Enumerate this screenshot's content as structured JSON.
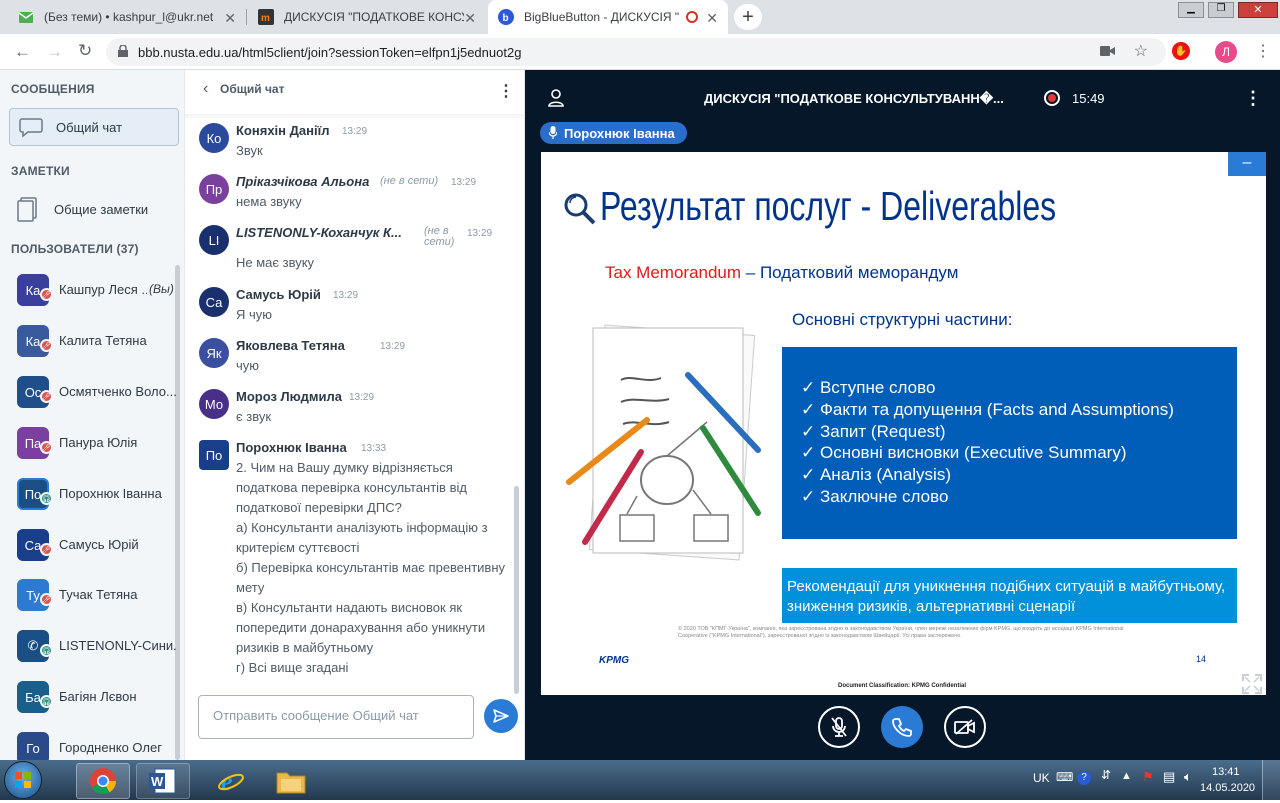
{
  "browser": {
    "tabs": [
      {
        "title": "(Без теми) • kashpur_l@ukr.net"
      },
      {
        "title": "ДИСКУСІЯ \"ПОДАТКОВЕ КОНСУ"
      },
      {
        "title": "BigBlueButton - ДИСКУСІЯ \""
      }
    ],
    "new_tab_label": "+",
    "url": "bbb.nusta.edu.ua/html5client/join?sessionToken=elfpn1j5ednuot2g",
    "profile_initial": "Л"
  },
  "sidebar": {
    "messages_heading": "СООБЩЕНИЯ",
    "public_chat_label": "Общий чат",
    "notes_heading": "ЗАМЕТКИ",
    "shared_notes_label": "Общие заметки",
    "users_heading": "ПОЛЬЗОВАТЕЛИ (37)",
    "users": [
      {
        "initials": "Ка",
        "name": "Кашпур Леся ...",
        "suffix": "(Вы)",
        "color": "#3a3f9e",
        "badge": "muted"
      },
      {
        "initials": "Ка",
        "name": "Калита Тетяна",
        "color": "#3a5a9e",
        "badge": "muted"
      },
      {
        "initials": "Ос",
        "name": "Осмятченко Воло...",
        "color": "#1f4f8a",
        "badge": "muted"
      },
      {
        "initials": "Па",
        "name": "Панура Юлія",
        "color": "#7b3fa0",
        "badge": "muted"
      },
      {
        "initials": "По",
        "name": "Порохнюк Іванна",
        "color": "#1a4f86",
        "badge": "listen"
      },
      {
        "initials": "Са",
        "name": "Самусь Юрій",
        "color": "#1a3f8a",
        "badge": "muted"
      },
      {
        "initials": "Ту",
        "name": "Тучак Тетяна",
        "color": "#2d7bd0",
        "badge": "muted"
      },
      {
        "initials": "",
        "name": "LISTENONLY-Сини...",
        "color": "#1a4f86",
        "badge": "listen"
      },
      {
        "initials": "Ба",
        "name": "Багіян Лєвон",
        "color": "#1a5f8a",
        "badge": "listen"
      },
      {
        "initials": "Го",
        "name": "Городненко Олег",
        "color": "#2b4a8a",
        "badge": "none"
      }
    ]
  },
  "chat": {
    "title": "Общий чат",
    "input_placeholder": "Отправить сообщение Общий чат",
    "messages": [
      {
        "initials": "Ко",
        "name": "Коняхін Даніїл",
        "time": "13:29",
        "status": "",
        "text": "Звук",
        "color": "#2b4a9e"
      },
      {
        "initials": "Пр",
        "name": "Пріказчікова Альона",
        "time": "13:29",
        "status": "(не в сети)",
        "text": "нема звуку",
        "color": "#7b3fa0"
      },
      {
        "initials": "LI",
        "name": "LISTENONLY-Коханчук К...",
        "time": "13:29",
        "status": "(не в сети)",
        "text": "Не має звуку",
        "color": "#1a2f6e"
      },
      {
        "initials": "Са",
        "name": "Самусь Юрій",
        "time": "13:29",
        "status": "",
        "text": "Я чую",
        "color": "#1a2f6e"
      },
      {
        "initials": "Як",
        "name": "Яковлева Тетяна",
        "time": "13:29",
        "status": "",
        "text": "чую",
        "color": "#3a4fa0"
      },
      {
        "initials": "Мо",
        "name": "Мороз Людмила",
        "time": "13:29",
        "status": "",
        "text": "є звук",
        "color": "#4a2f8a"
      },
      {
        "initials": "По",
        "name": "Порохнюк Іванна",
        "time": "13:33",
        "status": "",
        "text": "2. Чим на Вашу думку відрізняється податкова перевірка консультантів від податкової перевірки ДПС?\nа) Консультанти аналізують інформацію з критерієм суттєвості\nб) Перевірка консультантів має превентивну мету\nв) Консультанти надають висновок як попередити донарахування або уникнути ризиків в майбутньому\nг) Всі вище згадані",
        "color": "#1a3f8a"
      }
    ]
  },
  "meeting": {
    "title": "ДИСКУСІЯ \"ПОДАТКОВЕ КОНСУЛЬТУВАНН�...",
    "timer": "15:49",
    "presenter": "Порохнюк Іванна"
  },
  "slide": {
    "heading": "Результат послуг - Deliverables",
    "subtitle_red": "Tax Memorandum",
    "subtitle_rest": " – Податковий меморандум",
    "section_title": "Основні структурні частини:",
    "items": [
      "Вступне слово",
      "Факти та допущення (Facts and Assumptions)",
      "Запит (Request)",
      "Основні висновки (Executive Summary)",
      "Аналіз (Analysis)",
      "Заключне слово"
    ],
    "recommendation": "Рекомендації для уникнення подібних ситуацій в майбутньому, зниження ризиків, альтернативні сценарії",
    "footer_logo": "KPMG",
    "footer_legal": "© 2020 ТОВ \"КПМГ-Україна\", компанія, яка зареєстрована згідно із законодавством України, член мережі незалежних фірм KPMG, що входять до асоціації KPMG International Cooperative (\"KPMG International\"), зареєстрованої згідно із законодавством Швейцарії. Усі права застережено.",
    "page_number": "14",
    "classification": "Document Classification: KPMG Confidential",
    "minimize_label": "–"
  },
  "taskbar": {
    "lang": "UK",
    "time": "13:41",
    "date": "14.05.2020"
  }
}
